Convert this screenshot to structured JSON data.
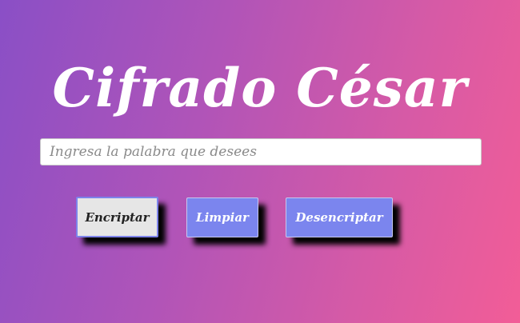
{
  "page": {
    "title": "Cifrado César"
  },
  "input": {
    "placeholder": "Ingresa la palabra que desees",
    "value": ""
  },
  "buttons": {
    "encrypt_label": "Encriptar",
    "clear_label": "Limpiar",
    "decrypt_label": "Desencriptar"
  },
  "colors": {
    "gradient_start": "#8a4fc6",
    "gradient_end": "#f25d97",
    "button_primary": "#7b85ee",
    "button_active": "#e6e6e6",
    "button_active_border": "#7d83ea"
  }
}
